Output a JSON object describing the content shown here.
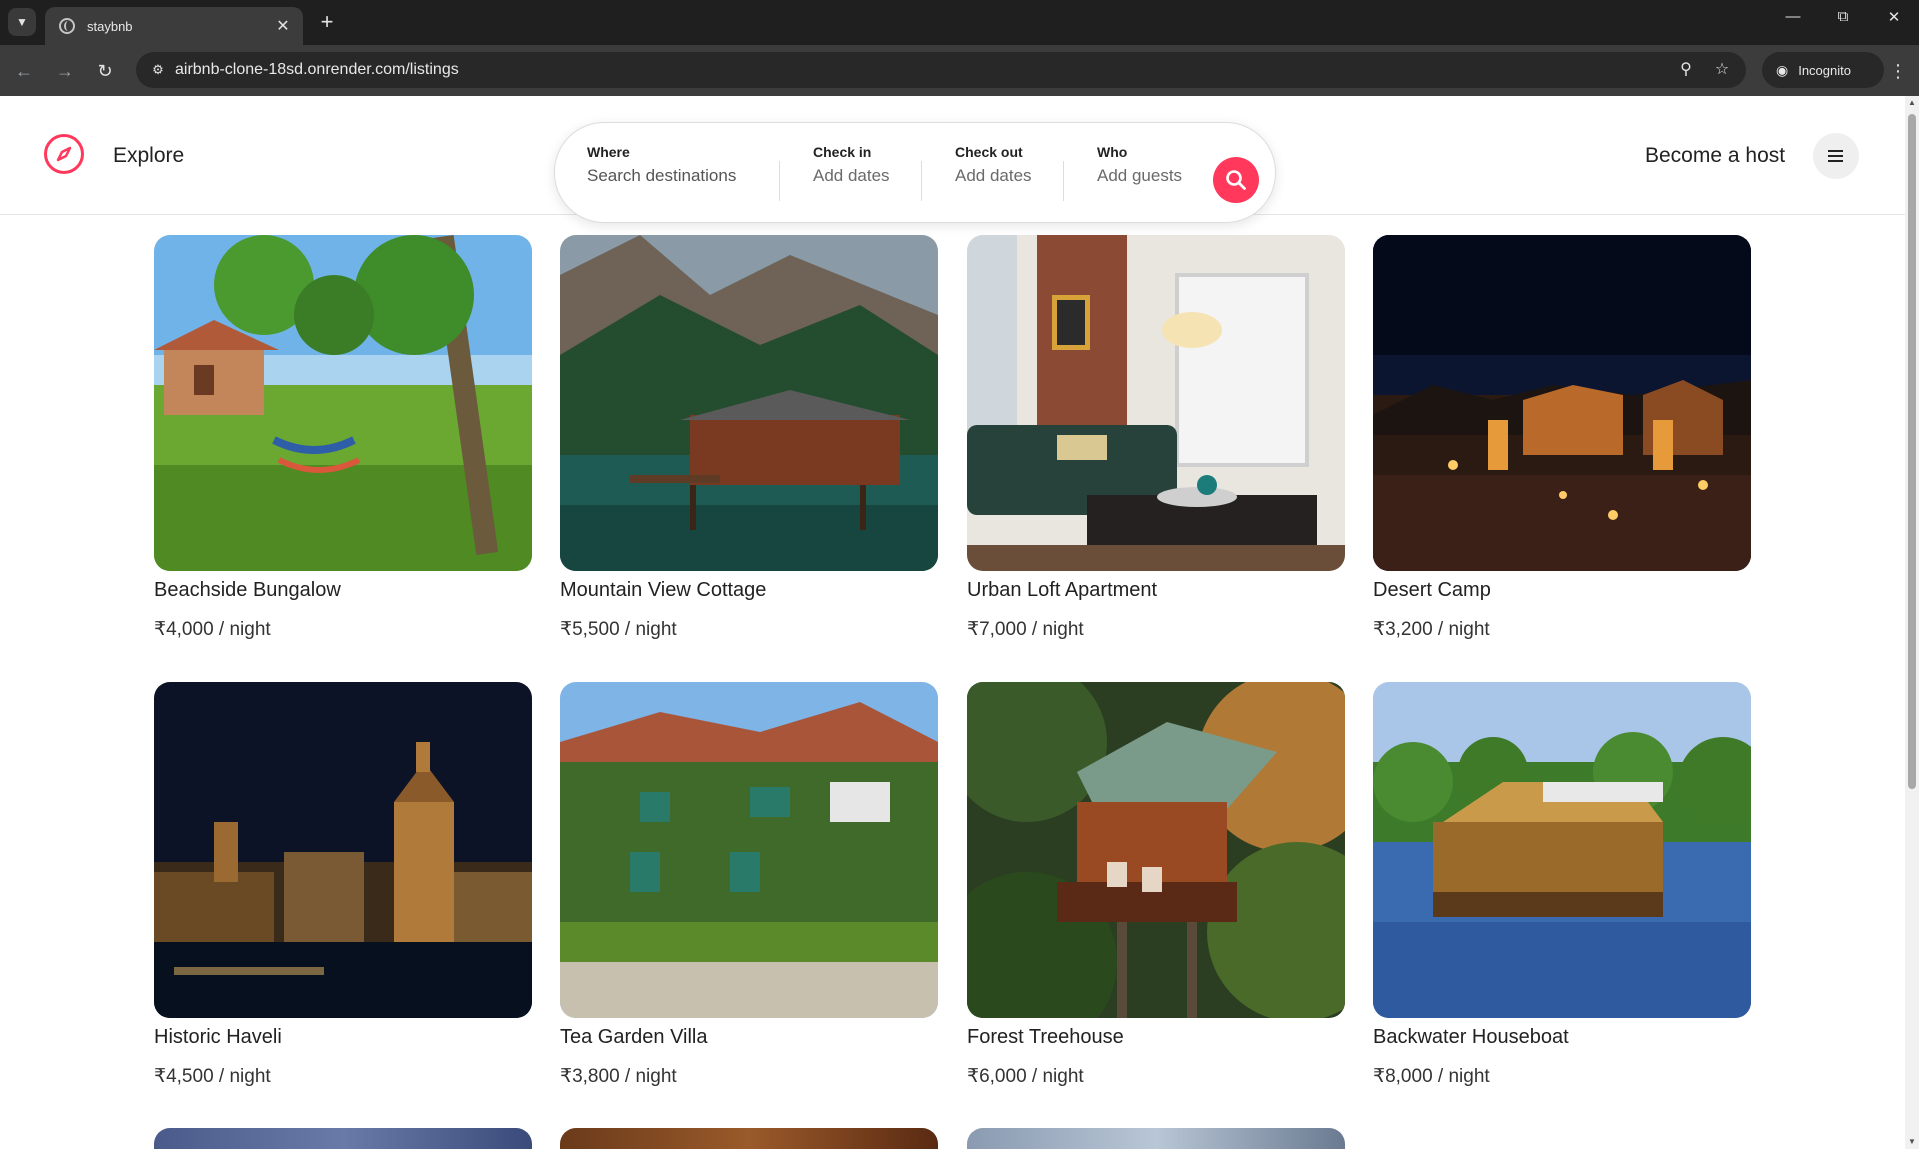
{
  "browser": {
    "tab_title": "staybnb",
    "url": "airbnb-clone-18sd.onrender.com/listings",
    "incognito_label": "Incognito"
  },
  "navbar": {
    "explore_label": "Explore",
    "become_host_label": "Become a host"
  },
  "search": {
    "where_label": "Where",
    "where_placeholder": "Search destinations",
    "checkin_label": "Check in",
    "checkin_value": "Add dates",
    "checkout_label": "Check out",
    "checkout_value": "Add dates",
    "who_label": "Who",
    "who_value": "Add guests"
  },
  "listings": [
    {
      "title": "Beachside Bungalow",
      "price": "₹4,000 / night"
    },
    {
      "title": "Mountain View Cottage",
      "price": "₹5,500 / night"
    },
    {
      "title": "Urban Loft Apartment",
      "price": "₹7,000 / night"
    },
    {
      "title": "Desert Camp",
      "price": "₹3,200 / night"
    },
    {
      "title": "Historic Haveli",
      "price": "₹4,500 / night"
    },
    {
      "title": "Tea Garden Villa",
      "price": "₹3,800 / night"
    },
    {
      "title": "Forest Treehouse",
      "price": "₹6,000 / night"
    },
    {
      "title": "Backwater Houseboat",
      "price": "₹8,000 / night"
    }
  ],
  "colors": {
    "brand": "#ff385c",
    "text": "#222222",
    "chrome_dark": "#202124"
  }
}
